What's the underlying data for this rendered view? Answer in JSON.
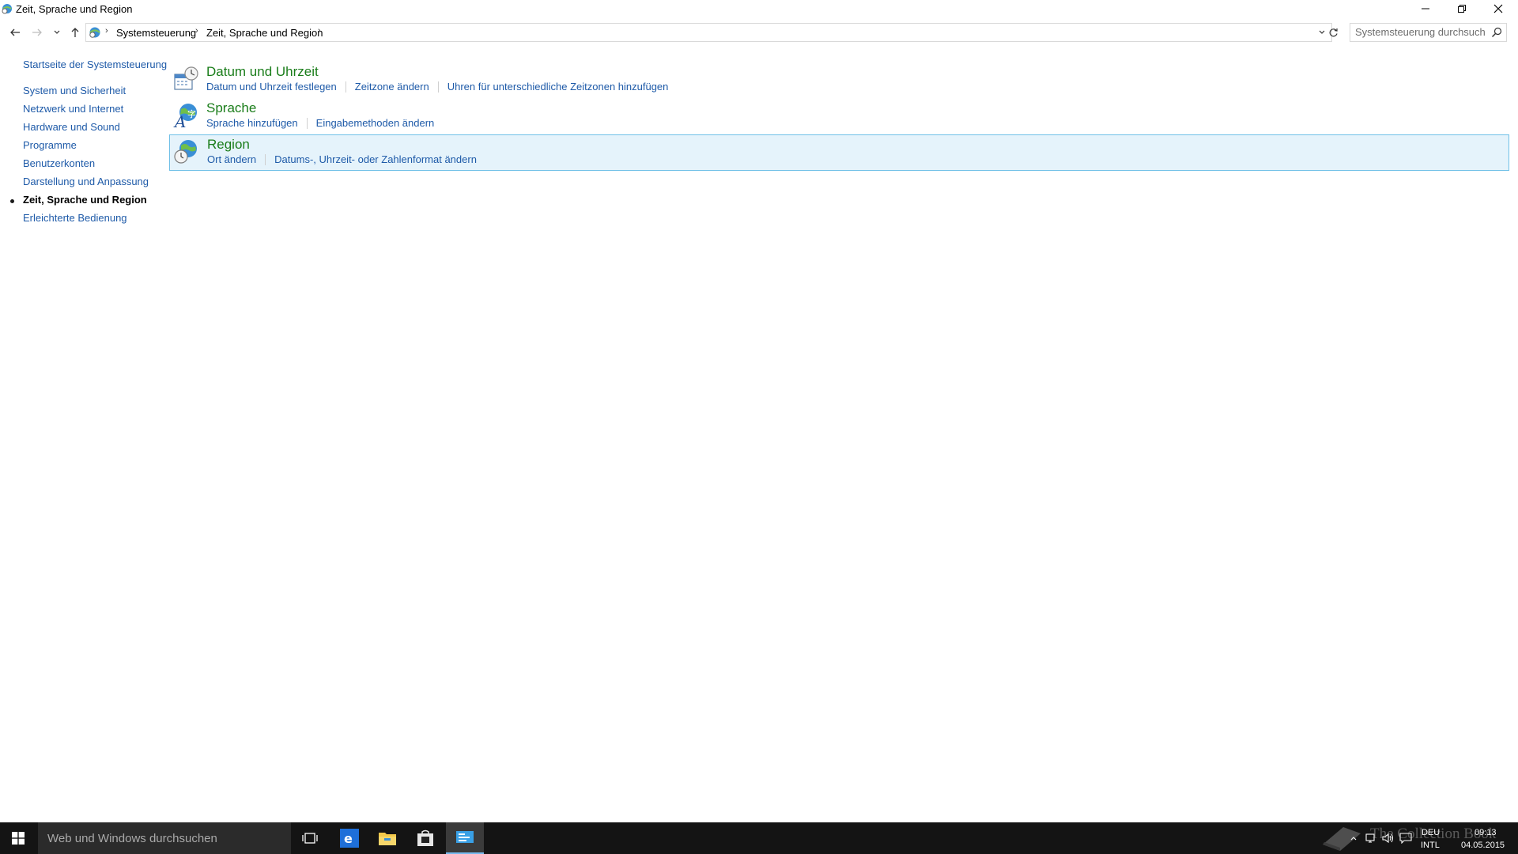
{
  "window": {
    "title": "Zeit, Sprache und Region"
  },
  "address_bar": {
    "breadcrumbs": [
      "Systemsteuerung",
      "Zeit, Sprache und Region"
    ]
  },
  "search": {
    "placeholder": "Systemsteuerung durchsuchen"
  },
  "sidebar": {
    "home_label": "Startseite der Systemsteuerung",
    "items": [
      {
        "label": "System und Sicherheit"
      },
      {
        "label": "Netzwerk und Internet"
      },
      {
        "label": "Hardware und Sound"
      },
      {
        "label": "Programme"
      },
      {
        "label": "Benutzerkonten"
      },
      {
        "label": "Darstellung und Anpassung"
      },
      {
        "label": "Zeit, Sprache und Region",
        "current": true
      },
      {
        "label": "Erleichterte Bedienung"
      }
    ]
  },
  "categories": [
    {
      "title": "Datum und Uhrzeit",
      "icon": "calendar-clock-icon",
      "links": [
        "Datum und Uhrzeit festlegen",
        "Zeitzone ändern",
        "Uhren für unterschiedliche Zeitzonen hinzufügen"
      ]
    },
    {
      "title": "Sprache",
      "icon": "language-globe-icon",
      "links": [
        "Sprache hinzufügen",
        "Eingabemethoden ändern"
      ]
    },
    {
      "title": "Region",
      "icon": "region-globe-clock-icon",
      "selected": true,
      "links": [
        "Ort ändern",
        "Datums-, Uhrzeit- oder Zahlenformat ändern"
      ]
    }
  ],
  "taskbar": {
    "search_placeholder": "Web und Windows durchsuchen",
    "apps": [
      "task-view-icon",
      "internet-explorer-icon",
      "file-explorer-icon",
      "store-icon",
      "control-panel-icon"
    ],
    "language_top": "DEU",
    "language_bottom": "INTL",
    "time": "09:13",
    "date": "04.05.2015"
  },
  "watermark": {
    "text": "The Collection Book"
  },
  "colors": {
    "link": "#1e5aa8",
    "category_title": "#1a7d1a",
    "selection_bg": "#e5f3fb",
    "selection_border": "#70c0e7",
    "taskbar": "#141414"
  }
}
